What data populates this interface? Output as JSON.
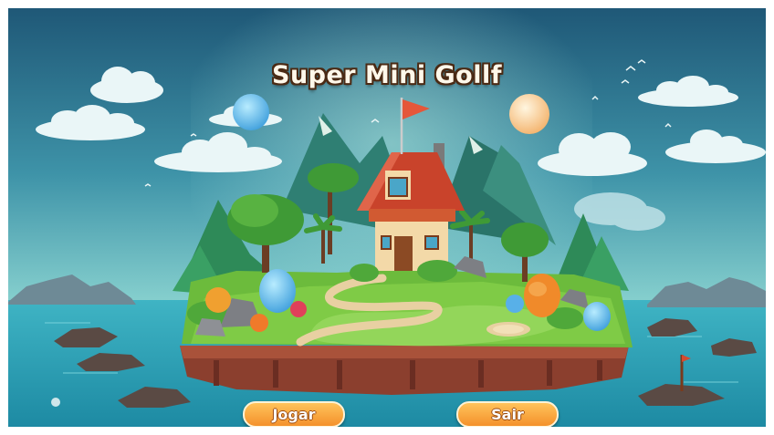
{
  "game": {
    "title": "Super Mini Gollf"
  },
  "menu": {
    "play_label": "Jogar",
    "exit_label": "Sair"
  },
  "colors": {
    "sky_top": "#235f80",
    "sky_bottom": "#6ec3c9",
    "sea": "#2a9fb2",
    "grass": "#6dbb3b",
    "roof": "#c9432b",
    "button": "#f7a23e",
    "flag": "#e5573a"
  }
}
